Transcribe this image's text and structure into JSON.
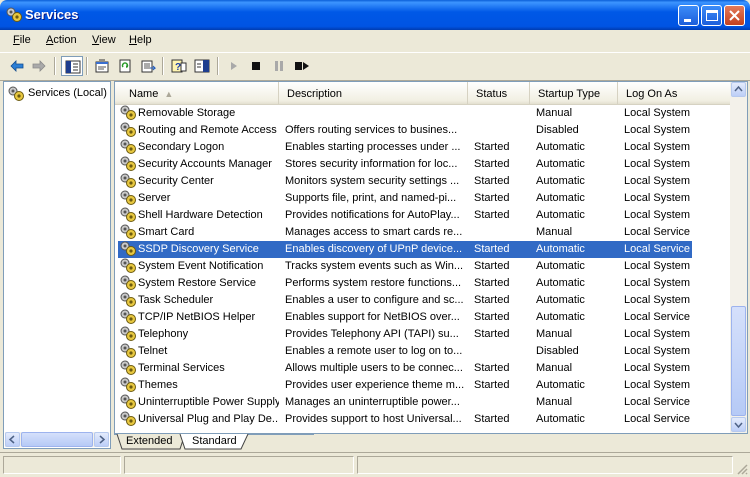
{
  "window": {
    "title": "Services"
  },
  "menu": [
    {
      "label": "File",
      "key": "F",
      "rest": "ile"
    },
    {
      "label": "Action",
      "key": "A",
      "rest": "ction"
    },
    {
      "label": "View",
      "key": "V",
      "rest": "iew"
    },
    {
      "label": "Help",
      "key": "H",
      "rest": "elp"
    }
  ],
  "tree": {
    "root_label": "Services (Local)"
  },
  "columns": {
    "name": "Name",
    "description": "Description",
    "status": "Status",
    "startup": "Startup Type",
    "logon": "Log On As"
  },
  "services": [
    {
      "name": "Removable Storage",
      "description": "",
      "status": "",
      "startup": "Manual",
      "logon": "Local System"
    },
    {
      "name": "Routing and Remote Access",
      "description": "Offers routing services to busines...",
      "status": "",
      "startup": "Disabled",
      "logon": "Local System"
    },
    {
      "name": "Secondary Logon",
      "description": "Enables starting processes under ...",
      "status": "Started",
      "startup": "Automatic",
      "logon": "Local System"
    },
    {
      "name": "Security Accounts Manager",
      "description": "Stores security information for loc...",
      "status": "Started",
      "startup": "Automatic",
      "logon": "Local System"
    },
    {
      "name": "Security Center",
      "description": "Monitors system security settings ...",
      "status": "Started",
      "startup": "Automatic",
      "logon": "Local System"
    },
    {
      "name": "Server",
      "description": "Supports file, print, and named-pi...",
      "status": "Started",
      "startup": "Automatic",
      "logon": "Local System"
    },
    {
      "name": "Shell Hardware Detection",
      "description": "Provides notifications for AutoPlay...",
      "status": "Started",
      "startup": "Automatic",
      "logon": "Local System"
    },
    {
      "name": "Smart Card",
      "description": "Manages access to smart cards re...",
      "status": "",
      "startup": "Manual",
      "logon": "Local Service"
    },
    {
      "name": "SSDP Discovery Service",
      "description": "Enables discovery of UPnP device...",
      "status": "Started",
      "startup": "Automatic",
      "logon": "Local Service",
      "selected": true
    },
    {
      "name": "System Event Notification",
      "description": "Tracks system events such as Win...",
      "status": "Started",
      "startup": "Automatic",
      "logon": "Local System"
    },
    {
      "name": "System Restore Service",
      "description": "Performs system restore functions...",
      "status": "Started",
      "startup": "Automatic",
      "logon": "Local System"
    },
    {
      "name": "Task Scheduler",
      "description": "Enables a user to configure and sc...",
      "status": "Started",
      "startup": "Automatic",
      "logon": "Local System"
    },
    {
      "name": "TCP/IP NetBIOS Helper",
      "description": "Enables support for NetBIOS over...",
      "status": "Started",
      "startup": "Automatic",
      "logon": "Local Service"
    },
    {
      "name": "Telephony",
      "description": "Provides Telephony API (TAPI) su...",
      "status": "Started",
      "startup": "Manual",
      "logon": "Local System"
    },
    {
      "name": "Telnet",
      "description": "Enables a remote user to log on to...",
      "status": "",
      "startup": "Disabled",
      "logon": "Local System"
    },
    {
      "name": "Terminal Services",
      "description": "Allows multiple users to be connec...",
      "status": "Started",
      "startup": "Manual",
      "logon": "Local System"
    },
    {
      "name": "Themes",
      "description": "Provides user experience theme m...",
      "status": "Started",
      "startup": "Automatic",
      "logon": "Local System"
    },
    {
      "name": "Uninterruptible Power Supply",
      "description": "Manages an uninterruptible power...",
      "status": "",
      "startup": "Manual",
      "logon": "Local Service"
    },
    {
      "name": "Universal Plug and Play De...",
      "description": "Provides support to host Universal...",
      "status": "Started",
      "startup": "Automatic",
      "logon": "Local Service"
    }
  ],
  "tabs": [
    {
      "label": "Extended"
    },
    {
      "label": "Standard",
      "active": true
    }
  ],
  "colors": {
    "titlebar": "#0054E3",
    "selection": "#316AC5",
    "chrome": "#ECE9D8"
  }
}
